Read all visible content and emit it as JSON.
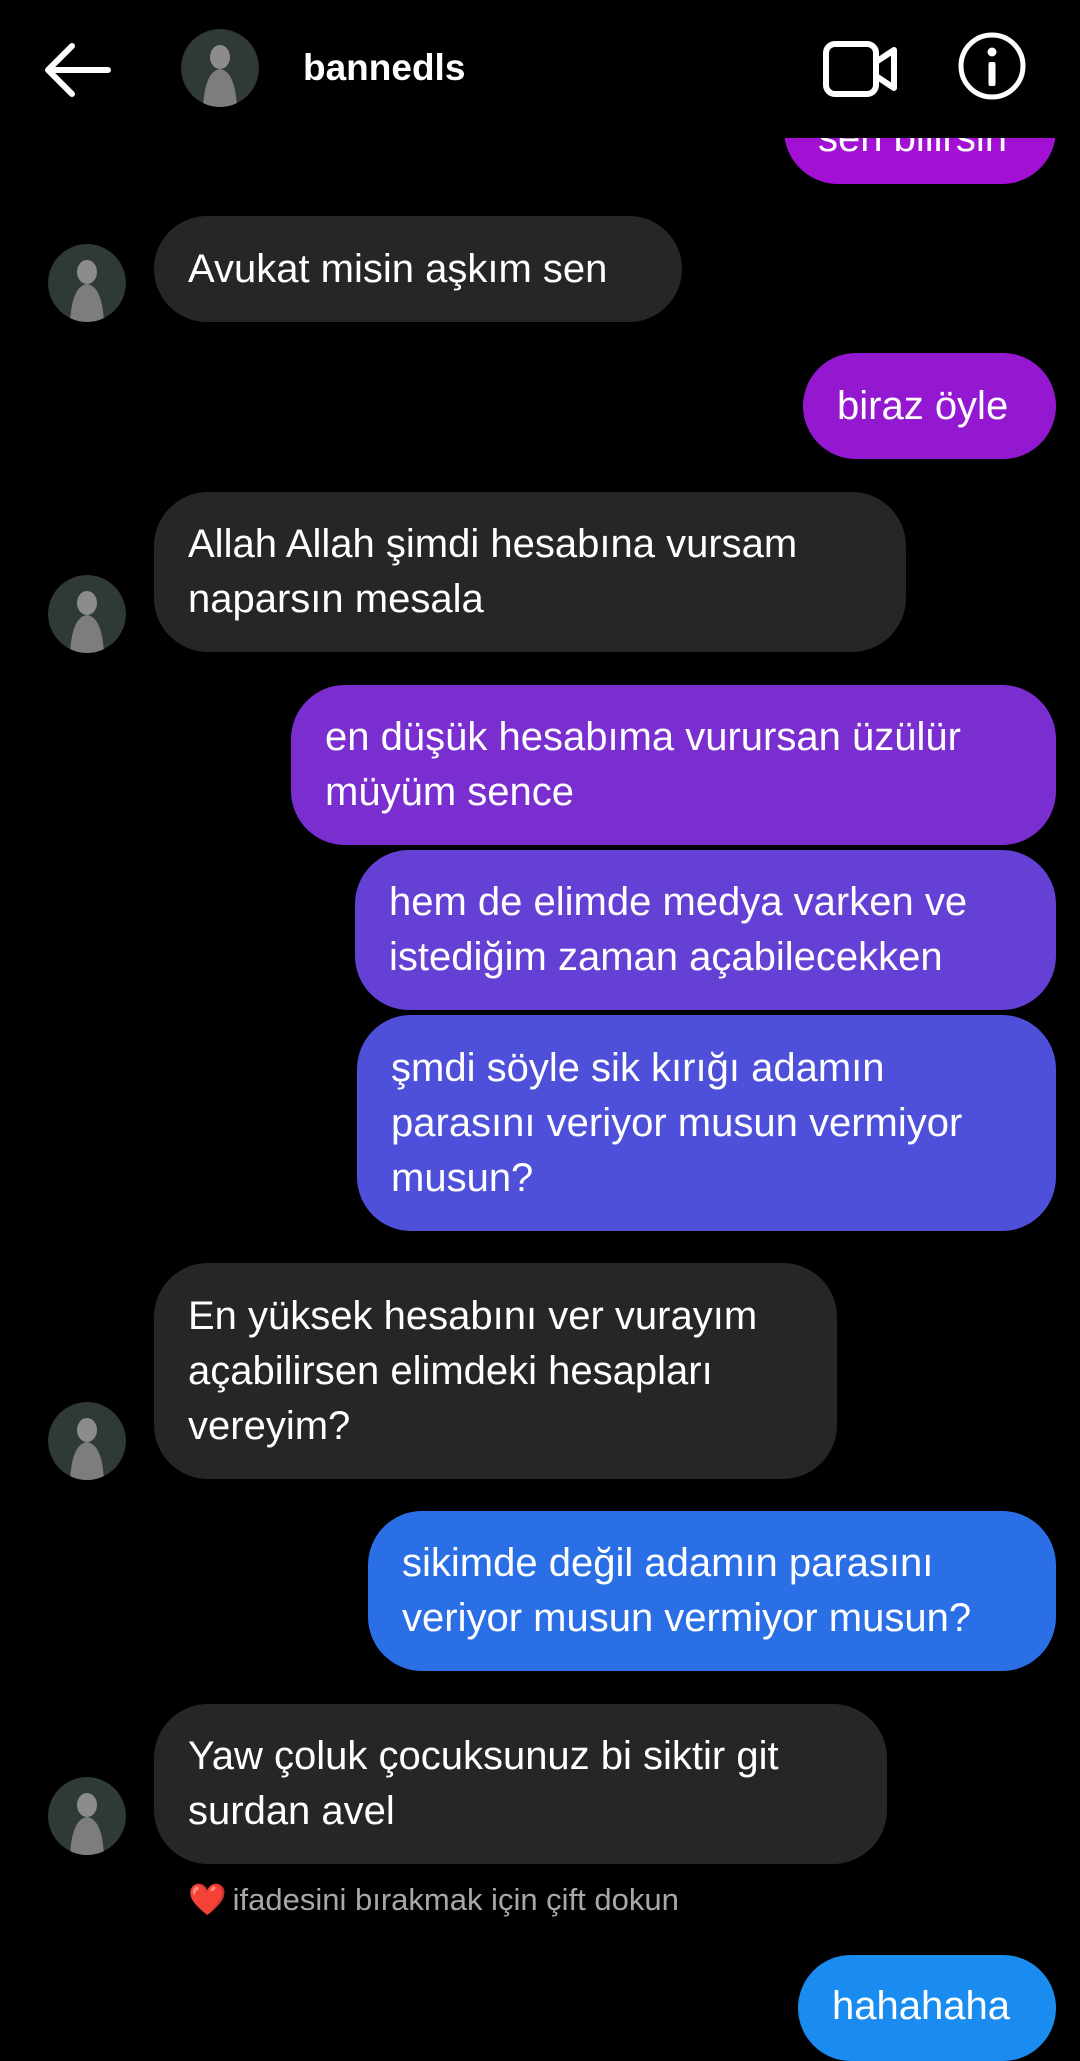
{
  "header": {
    "username": "bannedls",
    "icons": {
      "back": "arrow-left-icon",
      "video": "video-camera-icon",
      "info": "info-icon"
    }
  },
  "messages": [
    {
      "direction": "out",
      "text": "sen bilirsin",
      "color": "#a210d4"
    },
    {
      "direction": "in",
      "text": "Avukat misin aşkım sen"
    },
    {
      "direction": "out",
      "text": "biraz öyle",
      "color": "#9418d0"
    },
    {
      "direction": "in",
      "text": "Allah Allah şimdi hesabına vursam\nnaparsın mesala"
    },
    {
      "direction": "out",
      "text": "en düşük hesabıma vurursan üzülür\nmüyüm sence",
      "color": "#7a2ed0"
    },
    {
      "direction": "out",
      "text": "hem de elimde medya varken ve\nistediğim zaman açabilecekken",
      "color": "#6540d4"
    },
    {
      "direction": "out",
      "text": "şmdi söyle sik kırığı adamın\nparasını veriyor musun vermiyor\nmusun?",
      "color": "#4f50da"
    },
    {
      "direction": "in",
      "text": "En yüksek hesabını ver vurayım\naçabilirsen elimdeki hesapları\nvereyim?"
    },
    {
      "direction": "out",
      "text": "sikimde değil adamın parasını\nveriyor musun vermiyor musun?",
      "color": "#2a6fe6"
    },
    {
      "direction": "in",
      "text": "Yaw çoluk çocuksunuz bi siktir git\nsurdan avel"
    },
    {
      "direction": "out",
      "text": "hahahaha",
      "color": "#1a8cf0"
    }
  ],
  "reaction_hint": {
    "emoji": "❤️",
    "text": "ifadesini bırakmak için çift dokun"
  },
  "colors": {
    "background": "#000000",
    "incoming_bubble": "#262626",
    "hint_text": "#a8a8a8"
  }
}
